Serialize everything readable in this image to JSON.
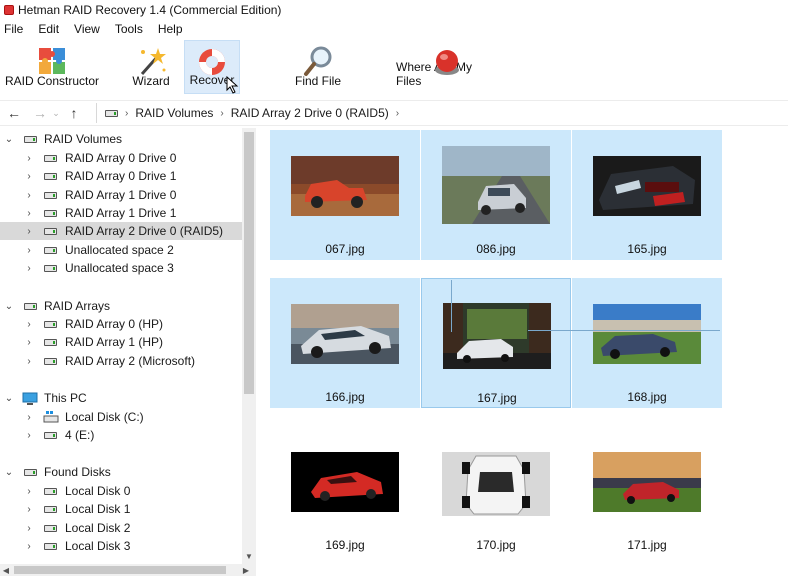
{
  "window": {
    "title": "Hetman RAID Recovery 1.4 (Commercial Edition)"
  },
  "menu": [
    "File",
    "Edit",
    "View",
    "Tools",
    "Help"
  ],
  "toolbar": {
    "raid_constructor": "RAID Constructor",
    "wizard": "Wizard",
    "recover": "Recover",
    "find_file": "Find File",
    "where_are_my_files": "Where Are My Files"
  },
  "address": {
    "crumbs": [
      "RAID Volumes",
      "RAID Array 2 Drive 0 (RAID5)"
    ]
  },
  "tree": {
    "raid_volumes": {
      "label": "RAID Volumes",
      "items": [
        "RAID Array 0 Drive 0",
        "RAID Array 0 Drive 1",
        "RAID Array 1 Drive 0",
        "RAID Array 1 Drive 1",
        "RAID Array 2 Drive 0 (RAID5)",
        "Unallocated space 2",
        "Unallocated space 3"
      ]
    },
    "raid_arrays": {
      "label": "RAID Arrays",
      "items": [
        "RAID Array 0 (HP)",
        "RAID Array 1 (HP)",
        "RAID Array 2 (Microsoft)"
      ]
    },
    "this_pc": {
      "label": "This PC",
      "items": [
        "Local Disk (C:)",
        "4 (E:)"
      ]
    },
    "found_disks": {
      "label": "Found Disks",
      "items": [
        "Local Disk 0",
        "Local Disk 1",
        "Local Disk 2",
        "Local Disk 3"
      ]
    },
    "selected_item": "RAID Array 2 Drive 0 (RAID5)"
  },
  "files": [
    "067.jpg",
    "086.jpg",
    "165.jpg",
    "166.jpg",
    "167.jpg",
    "168.jpg",
    "169.jpg",
    "170.jpg",
    "171.jpg"
  ],
  "colors": {
    "selection": "#cce8fb",
    "tree_selection": "#d9d9d9"
  }
}
